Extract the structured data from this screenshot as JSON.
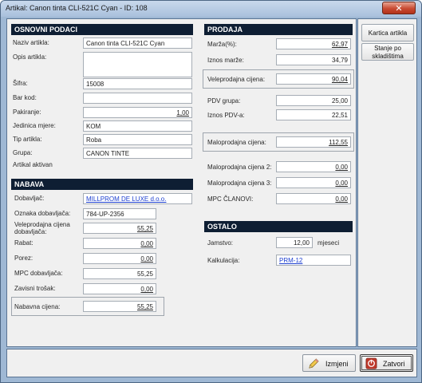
{
  "window": {
    "title": "Artikal: Canon tinta CLI-521C Cyan - ID: 108"
  },
  "osnovni": {
    "header": "OSNOVNI PODACI",
    "naziv_label": "Naziv artikla:",
    "naziv_value": "Canon tinta CLI-521C Cyan",
    "opis_label": "Opis artikla:",
    "opis_value": "",
    "sifra_label": "Šifra:",
    "sifra_value": "15008",
    "barkod_label": "Bar kod:",
    "barkod_value": "",
    "pakiranje_label": "Pakiranje:",
    "pakiranje_value": "1,00",
    "jedinica_label": "Jedinica mjere:",
    "jedinica_value": "KOM",
    "tip_label": "Tip artikla:",
    "tip_value": "Roba",
    "grupa_label": "Grupa:",
    "grupa_value": "CANON TINTE",
    "aktivan_label": "Artikal aktivan"
  },
  "nabava": {
    "header": "NABAVA",
    "dobavljac_label": "Dobavljač:",
    "dobavljac_value": "MILLPROM DE LUXE d.o.o.",
    "oznaka_label": "Oznaka dobavljača:",
    "oznaka_value": "784-UP-2356",
    "vpc_label": "Veleprodajna cijena dobavljača:",
    "vpc_value": "55,25",
    "rabat_label": "Rabat:",
    "rabat_value": "0,00",
    "porez_label": "Porez:",
    "porez_value": "0,00",
    "mpc_label": "MPC dobavljača:",
    "mpc_value": "55,25",
    "zavisni_label": "Zavisni trošak:",
    "zavisni_value": "0,00",
    "nabavna_label": "Nabavna cijena:",
    "nabavna_value": "55,25"
  },
  "prodaja": {
    "header": "PRODAJA",
    "marza_label": "Marža(%):",
    "marza_value": "62,97",
    "iznos_marze_label": "Iznos marže:",
    "iznos_marze_value": "34,79",
    "vpc_label": "Veleprodajna cijena:",
    "vpc_value": "90,04",
    "pdv_grupa_label": "PDV grupa:",
    "pdv_grupa_value": "25,00",
    "iznos_pdv_label": "Iznos PDV-a:",
    "iznos_pdv_value": "22,51",
    "mpc_label": "Maloprodajna cijena:",
    "mpc_value": "112,55",
    "mpc2_label": "Maloprodajna cijena 2:",
    "mpc2_value": "0,00",
    "mpc3_label": "Maloprodajna cijena 3:",
    "mpc3_value": "0,00",
    "mpc_clanovi_label": "MPC  ČLANOVI:",
    "mpc_clanovi_value": "0,00"
  },
  "ostalo": {
    "header": "OSTALO",
    "jamstvo_label": "Jamstvo:",
    "jamstvo_value": "12,00",
    "jamstvo_unit": "mjeseci",
    "kalkulacija_label": "Kalkulacija:",
    "kalkulacija_value": "PRM-12"
  },
  "side": {
    "kartica": "Kartica artikla",
    "stanje": "Stanje po skladištima"
  },
  "buttons": {
    "izmjeni": "Izmjeni",
    "zatvori": "Zatvori"
  },
  "icons": {
    "close": "close-icon",
    "izmjeni": "pencil-icon",
    "zatvori": "exit-icon"
  }
}
